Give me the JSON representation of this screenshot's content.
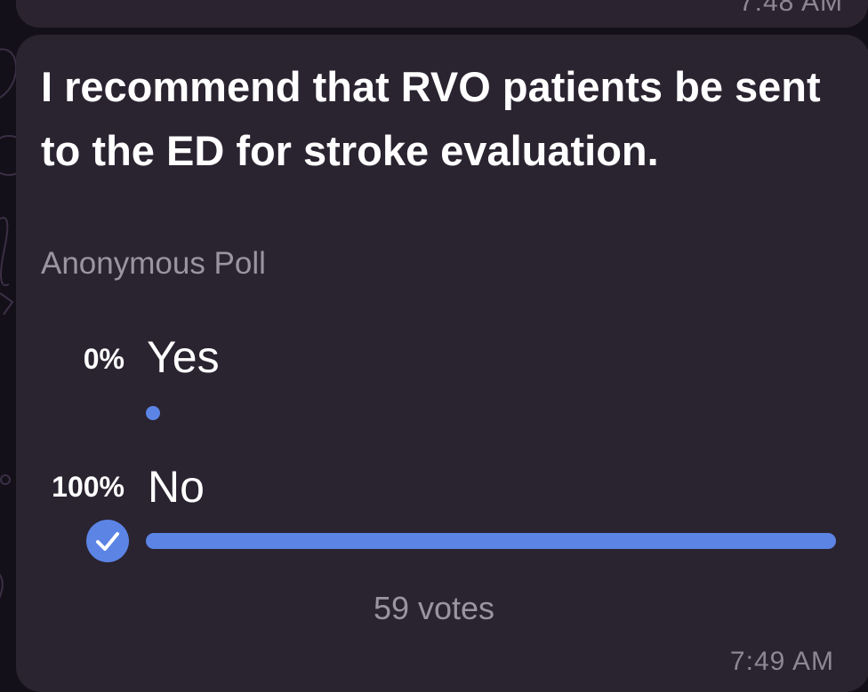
{
  "previous_message": {
    "time": "7:48 AM"
  },
  "poll": {
    "question": "I recommend that RVO patients be sent to the ED for stroke evaluation.",
    "type_label": "Anonymous Poll",
    "options": [
      {
        "percent_label": "0%",
        "label": "Yes",
        "fraction": 0.0,
        "selected": false
      },
      {
        "percent_label": "100%",
        "label": "No",
        "fraction": 1.0,
        "selected": true
      }
    ],
    "votes_label": "59 votes",
    "time": "7:49 AM"
  },
  "colors": {
    "accent": "#5b84e5",
    "bubble": "#2a2330",
    "background": "#141019",
    "secondary_text": "#9b95a1"
  },
  "icons": {
    "selected_option": "checkmark-circle-icon"
  }
}
